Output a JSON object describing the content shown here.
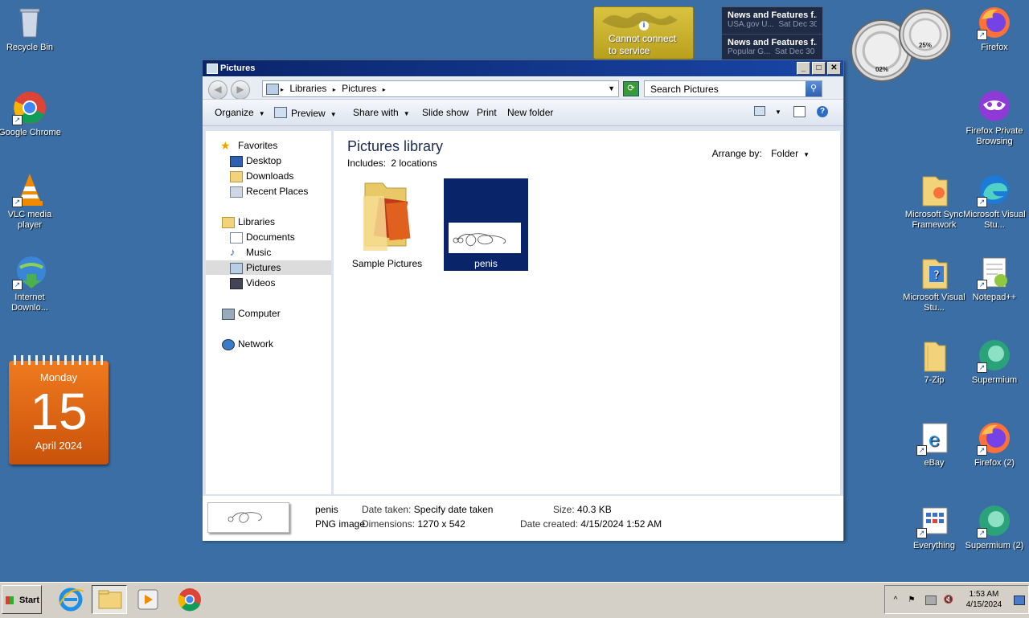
{
  "desktop": {
    "left_icons": [
      {
        "label": "Recycle Bin"
      },
      {
        "label": "Google Chrome"
      },
      {
        "label": "VLC media player"
      },
      {
        "label": "Internet Downlo..."
      }
    ],
    "right_icons": [
      {
        "label": "Firefox"
      },
      {
        "label": "Firefox Private Browsing"
      },
      {
        "label": "Microsoft Sync Framework"
      },
      {
        "label": "Microsoft Visual Stu..."
      },
      {
        "label": "Microsoft Visual Stu..."
      },
      {
        "label": "Notepad++"
      },
      {
        "label": "7-Zip"
      },
      {
        "label": "Supermium"
      },
      {
        "label": "eBay"
      },
      {
        "label": "Firefox (2)"
      },
      {
        "label": "Everything"
      },
      {
        "label": "Supermium (2)"
      }
    ]
  },
  "gadgets": {
    "calendar": {
      "weekday": "Monday",
      "day": "15",
      "month_year": "April 2024"
    },
    "weather": {
      "message_line1": "Cannot connect",
      "message_line2": "to service",
      "info_glyph": "i"
    },
    "news": [
      {
        "title": "News and Features f...",
        "source": "USA.gov U...",
        "date": "Sat Dec 30"
      },
      {
        "title": "News and Features f...",
        "source": "Popular G...",
        "date": "Sat Dec 30"
      }
    ],
    "meters": {
      "cpu": "02%",
      "memory": "25%"
    }
  },
  "window": {
    "title": "Pictures",
    "controls": {
      "minimize": "_",
      "maximize": "□",
      "close": "✕"
    },
    "address": {
      "crumbs": [
        "Libraries",
        "Pictures"
      ],
      "separator": "▸"
    },
    "search_placeholder": "Search Pictures",
    "commands": {
      "organize": "Organize",
      "preview": "Preview",
      "share": "Share with",
      "slideshow": "Slide show",
      "print": "Print",
      "new_folder": "New folder"
    },
    "nav": {
      "favorites": "Favorites",
      "desktop": "Desktop",
      "downloads": "Downloads",
      "recent": "Recent Places",
      "libraries": "Libraries",
      "documents": "Documents",
      "music": "Music",
      "pictures": "Pictures",
      "videos": "Videos",
      "computer": "Computer",
      "network": "Network"
    },
    "library": {
      "title": "Pictures library",
      "includes_label": "Includes:",
      "includes_value": "2 locations",
      "arrange_label": "Arrange by:",
      "arrange_value": "Folder"
    },
    "files": [
      {
        "name": "Sample Pictures",
        "type": "folder"
      },
      {
        "name": "penis",
        "type": "image",
        "selected": true
      }
    ],
    "details": {
      "name": "penis",
      "type": "PNG image",
      "date_taken_label": "Date taken:",
      "date_taken_value": "Specify date taken",
      "dimensions_label": "Dimensions:",
      "dimensions_value": "1270 x 542",
      "size_label": "Size:",
      "size_value": "40.3 KB",
      "date_created_label": "Date created:",
      "date_created_value": "4/15/2024 1:52 AM"
    }
  },
  "taskbar": {
    "start_label": "Start",
    "clock_time": "1:53 AM",
    "clock_date": "4/15/2024"
  },
  "colors": {
    "desktop_bg": "#3a6ea5",
    "titlebar": "#0a246a",
    "selection": "#0a246a",
    "calendar": "#e86d16"
  }
}
